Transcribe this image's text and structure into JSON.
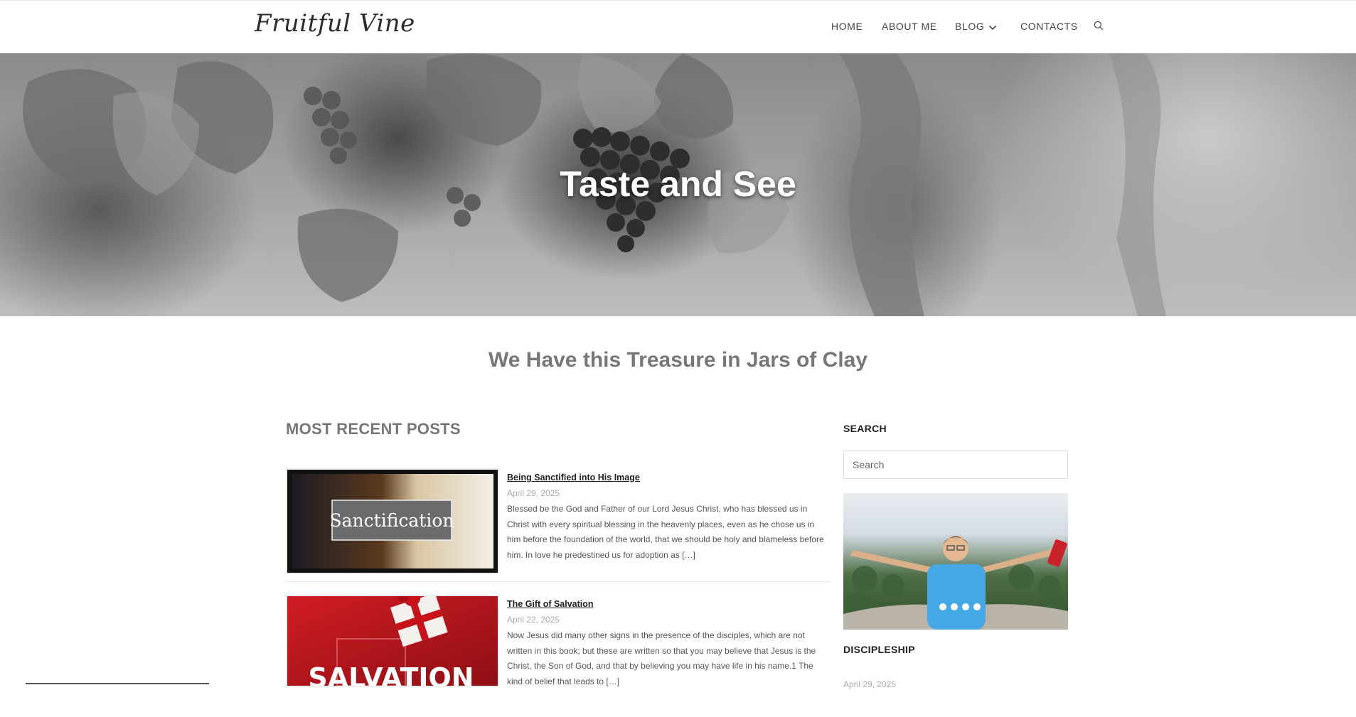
{
  "site": {
    "logo_text": "Fruitful Vine"
  },
  "nav": {
    "items": [
      {
        "label": "HOME"
      },
      {
        "label": "ABOUT ME"
      },
      {
        "label": "BLOG"
      },
      {
        "label": "CONTACTS"
      }
    ],
    "search_icon": "search-icon",
    "blog_dropdown_icon": "chevron-down-icon"
  },
  "hero": {
    "title": "Taste and See"
  },
  "tagline": "We Have this Treasure in Jars of Clay",
  "recent_posts": {
    "heading": "MOST RECENT POSTS",
    "posts": [
      {
        "title": "Being Sanctified into His Image",
        "date": "April 29, 2025",
        "excerpt": "Blessed be the God and Father of our Lord Jesus Christ, who has blessed us in Christ with every spiritual blessing in the heavenly places, even as he chose us in him before the foundation of the world, that we should be holy and blameless before him. In love he predestined us for adoption as […]",
        "thumb_label": "Sanctification"
      },
      {
        "title": "The Gift of Salvation",
        "date": "April 22, 2025",
        "excerpt": "Now Jesus did many other signs in the presence of the disciples, which are not written in this book; but these are written so that you may believe that Jesus is the Christ, the Son of God, and that by believing you may have life in his name.1 The kind of belief that leads to […]",
        "thumb_label": "SALVATION"
      }
    ]
  },
  "sidebar": {
    "search_heading": "SEARCH",
    "search_placeholder": "Search",
    "discipleship_heading": "DISCIPLESHIP",
    "discipleship_date": "April 29, 2025"
  },
  "colors": {
    "text_dark": "#222222",
    "text_muted": "#777777",
    "date_gray": "#aaaaaa",
    "salvation_red": "#b8141c"
  }
}
